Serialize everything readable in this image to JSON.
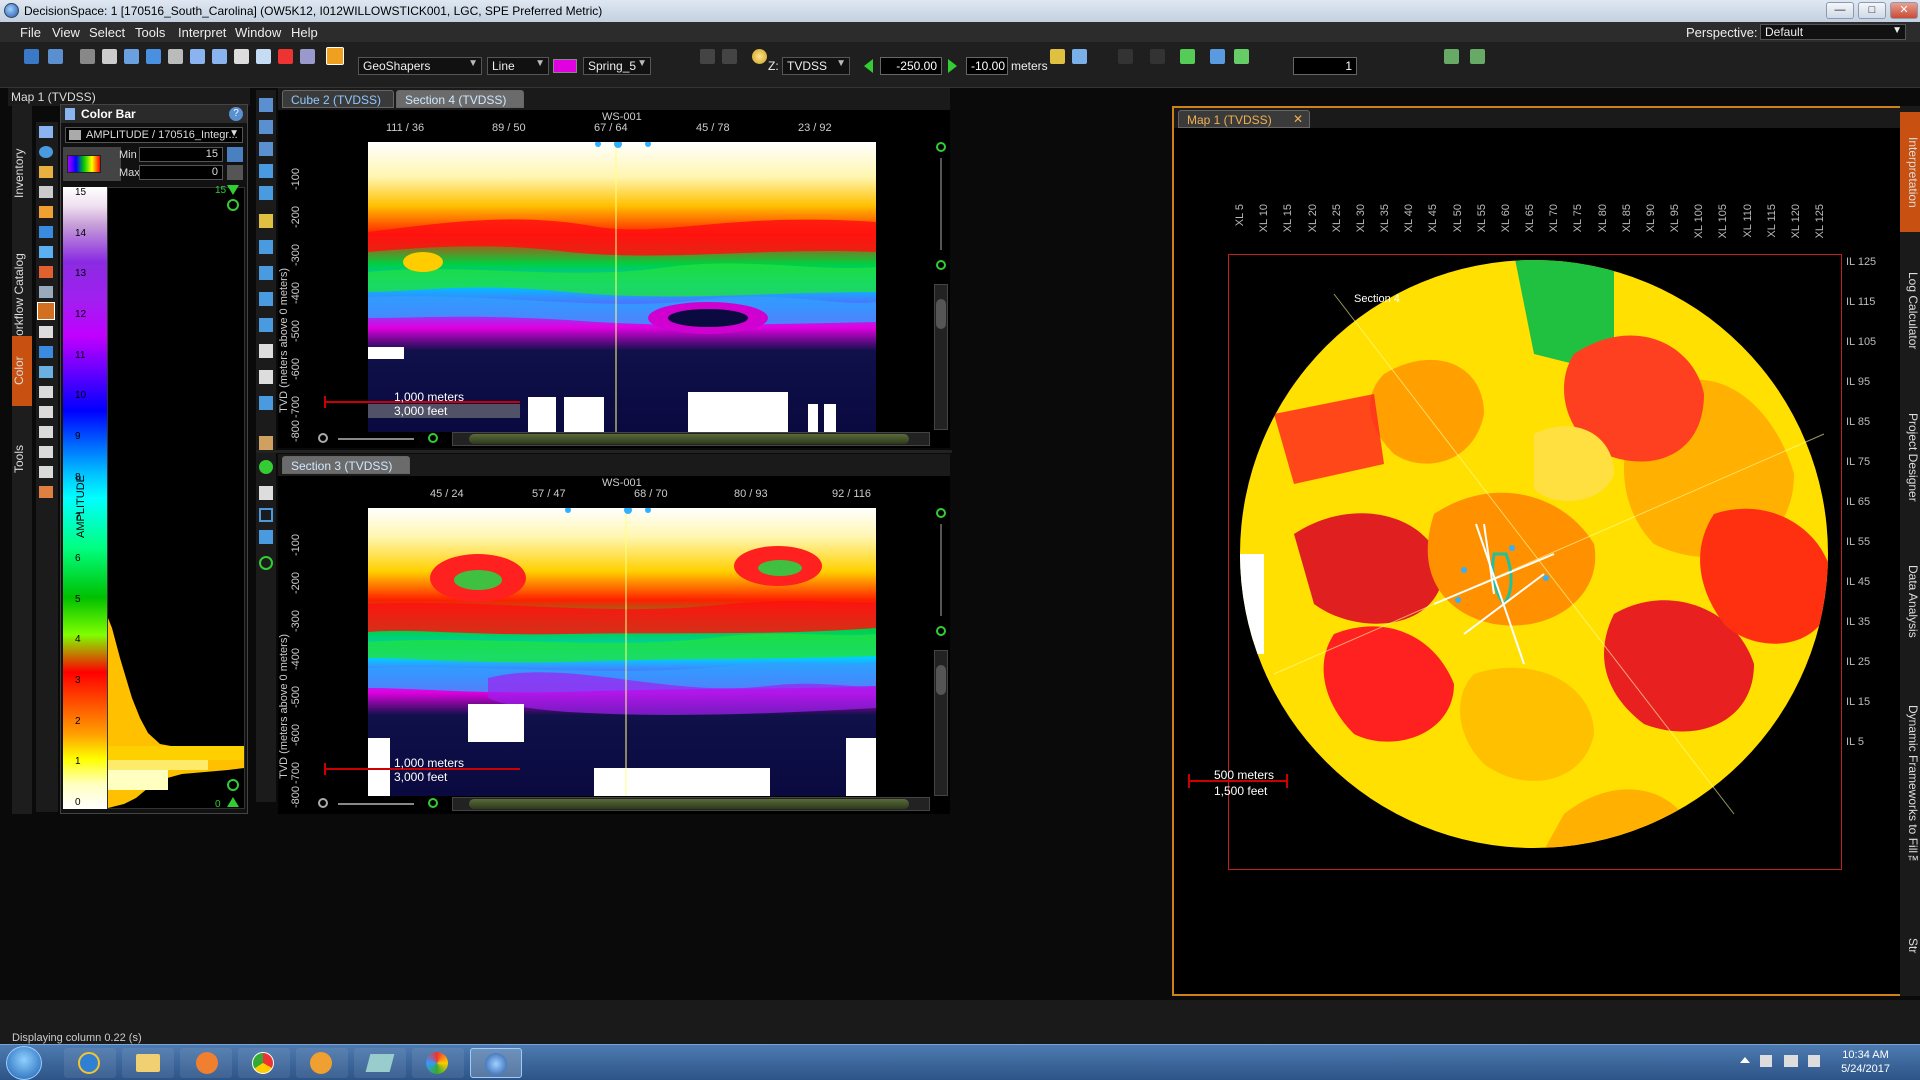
{
  "window": {
    "title": "DecisionSpace: 1 [170516_South_Carolina] (OW5K12, I012WILLOWSTICK001, LGC, SPE Preferred Metric)"
  },
  "menu": {
    "items": [
      "File",
      "View",
      "Select",
      "Tools",
      "Interpret",
      "Window",
      "Help"
    ],
    "perspective_label": "Perspective:",
    "perspective_value": "Default"
  },
  "toolbar": {
    "object_combo": "GeoShapers",
    "line_combo": "Line",
    "color_swatch": "#e000e0",
    "colormap_combo": "Spring_5",
    "domain_combo": "TVDSS",
    "domain_prefix": "Z:",
    "start_value": "-250.00",
    "step_value": "-10.00",
    "unit": "meters",
    "count_value": "1"
  },
  "left_panel": {
    "title": "Map 1 (TVDSS)",
    "side_tabs": [
      "Inventory",
      "Workflow Catalog",
      "Color",
      "Tools"
    ],
    "colorbar_title": "Color Bar",
    "attribute": "AMPLITUDE / 170516_Integr...",
    "min_label": "Min",
    "min_value": "15",
    "max_label": "Max",
    "max_value": "0",
    "axis_label": "AMPLITUDE",
    "ticks": [
      "15",
      "14",
      "13",
      "12",
      "11",
      "10",
      "9",
      "8",
      "7",
      "6",
      "5",
      "4",
      "3",
      "2",
      "1",
      "0"
    ],
    "top_marker": "15",
    "bottom_marker": "0"
  },
  "section_top": {
    "tabs": [
      "Cube 2 (TVDSS)",
      "Section 4 (TVDSS)"
    ],
    "well_label": "WS-001",
    "trace_ticks": [
      "111 / 36",
      "89 / 50",
      "67 / 64",
      "45 / 78",
      "23 / 92"
    ],
    "depth_ticks": [
      "-100",
      "-200",
      "-300",
      "-400",
      "-500",
      "-600",
      "-700",
      "-800"
    ],
    "y_axis_label": "TVD (meters above 0 meters)",
    "scale_m": "1,000 meters",
    "scale_ft": "3,000 feet"
  },
  "section_bottom": {
    "tabs": [
      "Section 3 (TVDSS)"
    ],
    "well_label": "WS-001",
    "trace_ticks": [
      "45 / 24",
      "57 / 47",
      "68 / 70",
      "80 / 93",
      "92 / 116"
    ],
    "depth_ticks": [
      "-100",
      "-200",
      "-300",
      "-400",
      "-500",
      "-600",
      "-700",
      "-800"
    ],
    "y_axis_label": "TVD (meters above 0 meters)",
    "scale_m": "1,000 meters",
    "scale_ft": "3,000 feet"
  },
  "map": {
    "tab": "Map 1 (TVDSS)",
    "xl_ticks": [
      "XL 5",
      "XL 10",
      "XL 15",
      "XL 20",
      "XL 25",
      "XL 30",
      "XL 35",
      "XL 40",
      "XL 45",
      "XL 50",
      "XL 55",
      "XL 60",
      "XL 65",
      "XL 70",
      "XL 75",
      "XL 80",
      "XL 85",
      "XL 90",
      "XL 95",
      "XL 100",
      "XL 105",
      "XL 110",
      "XL 115",
      "XL 120",
      "XL 125"
    ],
    "il_ticks": [
      "IL 125",
      "IL 115",
      "IL 105",
      "IL 95",
      "IL 85",
      "IL 75",
      "IL 65",
      "IL 55",
      "IL 45",
      "IL 35",
      "IL 25",
      "IL 15",
      "IL 5"
    ],
    "section_label": "Section 4",
    "scale_m": "500 meters",
    "scale_ft": "1,500 feet"
  },
  "right_tabs": [
    "Interpretation",
    "Log Calculator",
    "Project Designer",
    "Data Analysis",
    "Dynamic Frameworks to Fill™",
    "Str"
  ],
  "status": {
    "text": "Displaying column 0.22 (s)"
  },
  "taskbar": {
    "time": "10:34 AM",
    "date": "5/24/2017"
  }
}
